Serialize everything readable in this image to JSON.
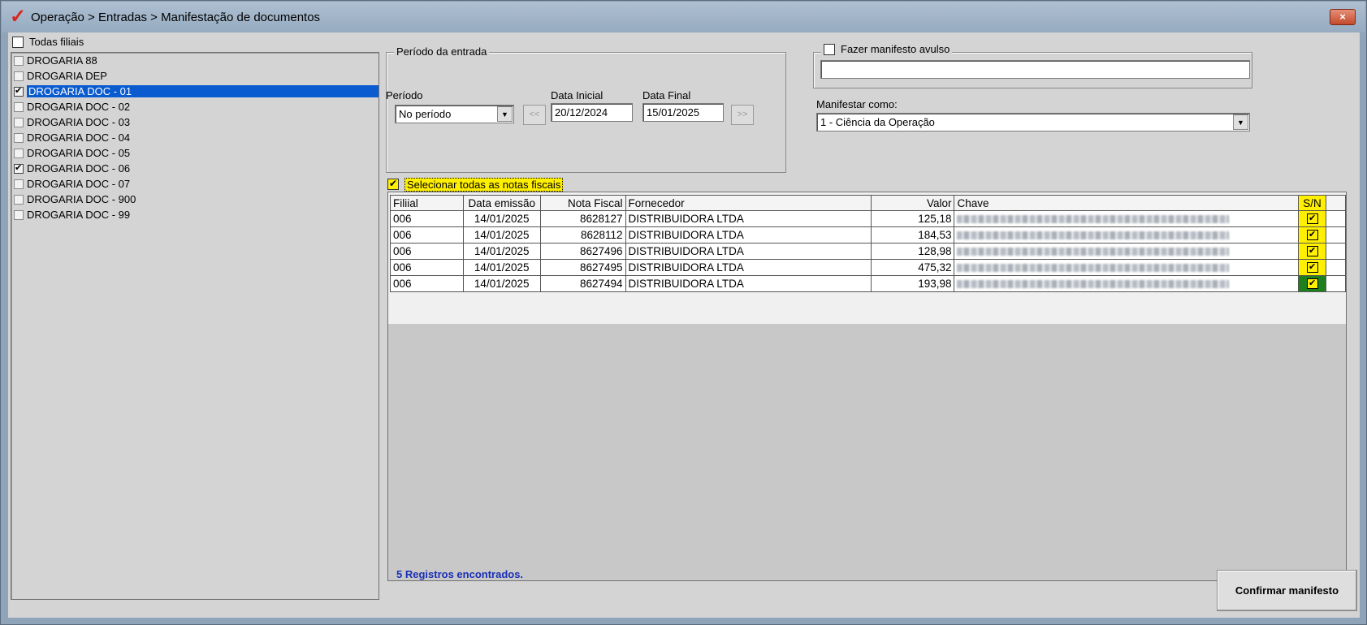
{
  "window": {
    "title": "Operação > Entradas > Manifestação de documentos",
    "close_label": "×"
  },
  "filiais": {
    "all_label": "Todas filiais",
    "items": [
      {
        "label": "DROGARIA 88",
        "checked": false,
        "selected": false
      },
      {
        "label": "DROGARIA DEP",
        "checked": false,
        "selected": false
      },
      {
        "label": "DROGARIA DOC - 01",
        "checked": true,
        "selected": true
      },
      {
        "label": "DROGARIA DOC - 02",
        "checked": false,
        "selected": false
      },
      {
        "label": "DROGARIA DOC - 03",
        "checked": false,
        "selected": false
      },
      {
        "label": "DROGARIA DOC - 04",
        "checked": false,
        "selected": false
      },
      {
        "label": "DROGARIA DOC - 05",
        "checked": false,
        "selected": false
      },
      {
        "label": "DROGARIA DOC - 06",
        "checked": true,
        "selected": false
      },
      {
        "label": "DROGARIA DOC - 07",
        "checked": false,
        "selected": false
      },
      {
        "label": "DROGARIA DOC - 900",
        "checked": false,
        "selected": false
      },
      {
        "label": "DROGARIA DOC - 99",
        "checked": false,
        "selected": false
      }
    ]
  },
  "periodo": {
    "group_title": "Período da entrada",
    "periodo_label": "Período",
    "periodo_value": "No período",
    "data_inicial_label": "Data Inicial",
    "data_inicial_value": "20/12/2024",
    "data_final_label": "Data Final",
    "data_final_value": "15/01/2025",
    "prev_label": "<<",
    "next_label": ">>"
  },
  "avulso": {
    "label": "Fazer manifesto avulso",
    "value": ""
  },
  "manifestar": {
    "label": "Manifestar como:",
    "value": "1 - Ciência da Operação"
  },
  "selecionar_todas": "Selecionar todas as notas fiscais",
  "grid": {
    "headers": {
      "filial": "Filiial",
      "data_emissao": "Data emissão",
      "nota_fiscal": "Nota Fiscal",
      "fornecedor": "Fornecedor",
      "valor": "Valor",
      "chave": "Chave",
      "sn": "S/N"
    },
    "rows": [
      {
        "filial": "006",
        "data": "14/01/2025",
        "nota": "8628127",
        "fornecedor": "DISTRIBUIDORA  LTDA",
        "valor": "125,18",
        "sn": "✔"
      },
      {
        "filial": "006",
        "data": "14/01/2025",
        "nota": "8628112",
        "fornecedor": "DISTRIBUIDORA  LTDA",
        "valor": "184,53",
        "sn": "✔"
      },
      {
        "filial": "006",
        "data": "14/01/2025",
        "nota": "8627496",
        "fornecedor": "DISTRIBUIDORA  LTDA",
        "valor": "128,98",
        "sn": "✔"
      },
      {
        "filial": "006",
        "data": "14/01/2025",
        "nota": "8627495",
        "fornecedor": "DISTRIBUIDORA  LTDA",
        "valor": "475,32",
        "sn": "✔"
      },
      {
        "filial": "006",
        "data": "14/01/2025",
        "nota": "8627494",
        "fornecedor": "DISTRIBUIDORA  LTDA",
        "valor": "193,98",
        "sn": "✔"
      }
    ]
  },
  "status": "5 Registros encontrados.",
  "confirm_label": "Confirmar manifesto",
  "colors": {
    "highlight": "#ffef00",
    "selection": "#0a5ad0",
    "status_text": "#1a2fb5"
  }
}
